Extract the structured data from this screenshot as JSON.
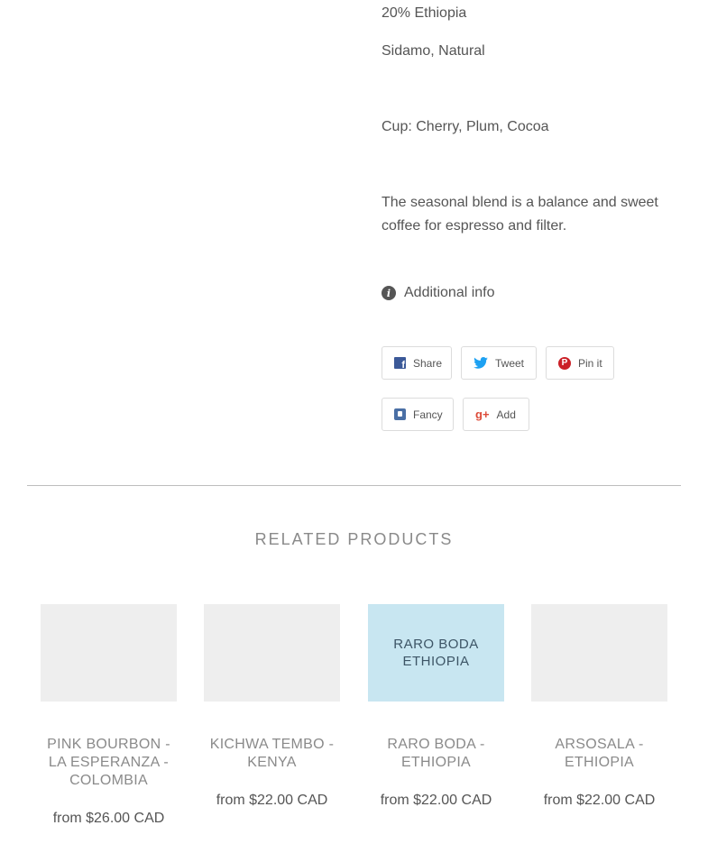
{
  "description": {
    "line1": "20% Ethiopia",
    "line2": "Sidamo, Natural",
    "line3": "Cup: Cherry, Plum, Cocoa",
    "line4": " The seasonal blend is a balance and sweet coffee for espresso and filter."
  },
  "additional_info": {
    "label": "Additional info",
    "icon": "info-icon"
  },
  "share_buttons": {
    "share": "Share",
    "tweet": "Tweet",
    "pin": "Pin it",
    "fancy": "Fancy",
    "add": "Add"
  },
  "related": {
    "title": "RELATED PRODUCTS",
    "products": [
      {
        "name": "PINK BOURBON - LA ESPERANZA - COLOMBIA",
        "price": "from $26.00 CAD",
        "thumb_text": ""
      },
      {
        "name": "KICHWA TEMBO - KENYA",
        "price": "from $22.00 CAD",
        "thumb_text": ""
      },
      {
        "name": "RARO BODA - ETHIOPIA",
        "price": "from $22.00 CAD",
        "thumb_text": "RARO BODA ETHIOPIA"
      },
      {
        "name": "ARSOSALA - ETHIOPIA",
        "price": "from $22.00 CAD",
        "thumb_text": ""
      }
    ]
  },
  "colors": {
    "facebook": "#3b5998",
    "twitter": "#1da1f2",
    "pinterest": "#cb2027",
    "google_plus": "#dd4b39",
    "raro_boda_thumb": "#c8e6f1"
  }
}
